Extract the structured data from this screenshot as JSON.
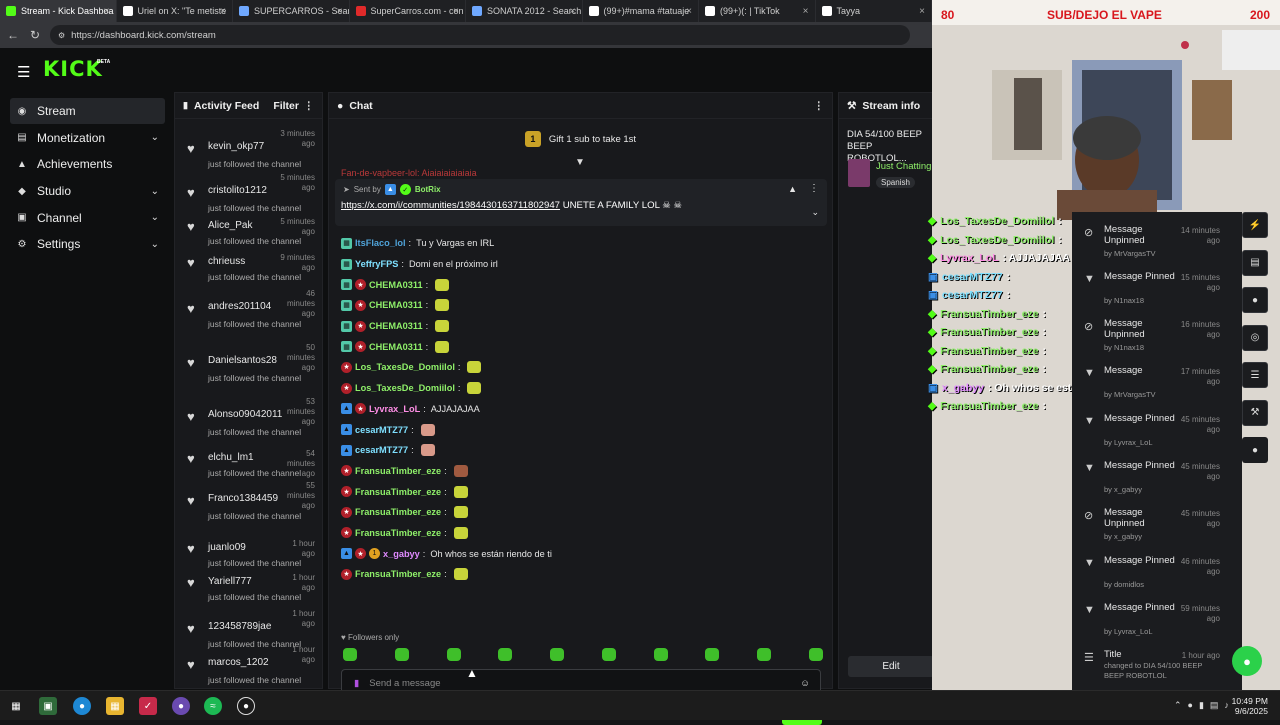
{
  "browser": {
    "tabs": [
      {
        "label": "Stream - Kick Dashboa",
        "icon": "kick-icon",
        "color": "#53fc18",
        "active": true
      },
      {
        "label": "Uriel on X: \"Te metiste",
        "icon": "x-icon",
        "color": "#ffffff",
        "active": false
      },
      {
        "label": "SUPERCARROS - Search",
        "icon": "search-icon",
        "color": "#6fa8ff",
        "active": false
      },
      {
        "label": "SuperCarros.com - con",
        "icon": "supercarros-icon",
        "color": "#e02a2a",
        "active": false
      },
      {
        "label": "SONATA 2012 - Search",
        "icon": "search-icon",
        "color": "#6fa8ff",
        "active": false
      },
      {
        "label": "(99+)#mama #tatuaje",
        "icon": "tiktok-icon",
        "color": "#ffffff",
        "active": false
      },
      {
        "label": "(99+)(: | TikTok",
        "icon": "tiktok-icon",
        "color": "#ffffff",
        "active": false
      },
      {
        "label": "Tayya",
        "icon": "tiktok-icon",
        "color": "#ffffff",
        "active": false
      }
    ],
    "url": "https://dashboard.kick.com/stream"
  },
  "brand": {
    "logo": "KICK",
    "beta": "BETA",
    "accent": "#53fc18"
  },
  "sidebar": {
    "items": [
      {
        "label": "Stream",
        "icon": "broadcast-icon",
        "active": true,
        "chevron": false
      },
      {
        "label": "Monetization",
        "icon": "wallet-icon",
        "active": false,
        "chevron": true
      },
      {
        "label": "Achievements",
        "icon": "trophy-icon",
        "active": false,
        "chevron": false
      },
      {
        "label": "Studio",
        "icon": "studio-icon",
        "active": false,
        "chevron": true
      },
      {
        "label": "Channel",
        "icon": "channel-icon",
        "active": false,
        "chevron": true
      },
      {
        "label": "Settings",
        "icon": "gear-icon",
        "active": false,
        "chevron": true
      }
    ]
  },
  "activity": {
    "title": "Activity Feed",
    "filter": "Filter",
    "items": [
      {
        "user": "kevin_okp77",
        "time": "3 minutes ago",
        "desc": "just followed the channel"
      },
      {
        "user": "cristolito1212",
        "time": "5 minutes ago",
        "desc": "just followed the channel"
      },
      {
        "user": "Alice_Pak",
        "time": "5 minutes ago",
        "desc": "just followed the channel"
      },
      {
        "user": "chrieuss",
        "time": "9 minutes ago",
        "desc": "just followed the channel"
      },
      {
        "user": "andres201104",
        "time": "46 minutes ago",
        "desc": "just followed the channel"
      },
      {
        "user": "Danielsantos28",
        "time": "50 minutes ago",
        "desc": "just followed the channel"
      },
      {
        "user": "Alonso09042011",
        "time": "53 minutes ago",
        "desc": "just followed the channel"
      },
      {
        "user": "elchu_lm1",
        "time": "54 minutes ago",
        "desc": "just followed the channel"
      },
      {
        "user": "Franco1384459",
        "time": "55 minutes ago",
        "desc": "just followed the channel"
      },
      {
        "user": "juanlo09",
        "time": "1 hour ago",
        "desc": "just followed the channel"
      },
      {
        "user": "Yariell777",
        "time": "1 hour ago",
        "desc": "just followed the channel"
      },
      {
        "user": "123458789jae",
        "time": "1 hour ago",
        "desc": "just followed the channel"
      },
      {
        "user": "marcos_1202",
        "time": "1 hour ago",
        "desc": "just followed the channel"
      }
    ]
  },
  "chat": {
    "title": "Chat",
    "gift_text": "Gift 1 sub to take 1st",
    "gift_rank": "1",
    "partial_msg": "Fan-de-vapbeer-lol: Aiaiaiaiaiaiaia",
    "pinned": {
      "sent_by": "Sent by",
      "bot": "BotRix",
      "link": "https://x.com/i/communities/1984430163711802947",
      "text": "UNETE A FAMILY LOL"
    },
    "messages": [
      {
        "user": "ItsFlaco_lol",
        "text": "Tu y Vargas en IRL",
        "color": "#4fa3d9",
        "emote": null
      },
      {
        "user": "YeffryFPS",
        "text": "Domi en el próximo irl",
        "color": "#7fe0ff",
        "emote": null
      },
      {
        "user": "CHEMA0311",
        "text": "",
        "color": "#8ff06a",
        "emote": "#c8d43a"
      },
      {
        "user": "CHEMA0311",
        "text": "",
        "color": "#8ff06a",
        "emote": "#c8d43a"
      },
      {
        "user": "CHEMA0311",
        "text": "",
        "color": "#8ff06a",
        "emote": "#c8d43a"
      },
      {
        "user": "CHEMA0311",
        "text": "",
        "color": "#8ff06a",
        "emote": "#c8d43a"
      },
      {
        "user": "Los_TaxesDe_Domiilol",
        "text": "",
        "color": "#8ff06a",
        "emote": "#c8d43a"
      },
      {
        "user": "Los_TaxesDe_Domiilol",
        "text": "",
        "color": "#8ff06a",
        "emote": "#c8d43a"
      },
      {
        "user": "Lyvrax_LoL",
        "text": "AJJAJAJAA",
        "color": "#ff8ee6",
        "emote": null
      },
      {
        "user": "cesarMTZ77",
        "text": "",
        "color": "#7fe0ff",
        "emote": "#d99a8a"
      },
      {
        "user": "cesarMTZ77",
        "text": "",
        "color": "#7fe0ff",
        "emote": "#d99a8a"
      },
      {
        "user": "FransuaTimber_eze",
        "text": "",
        "color": "#8ff06a",
        "emote": "#a05a40"
      },
      {
        "user": "FransuaTimber_eze",
        "text": "",
        "color": "#8ff06a",
        "emote": "#c8d43a"
      },
      {
        "user": "FransuaTimber_eze",
        "text": "",
        "color": "#8ff06a",
        "emote": "#c8d43a"
      },
      {
        "user": "FransuaTimber_eze",
        "text": "",
        "color": "#8ff06a",
        "emote": "#c8d43a"
      },
      {
        "user": "x_gabyy",
        "text": "Oh whos se están riendo de ti",
        "color": "#e08aff",
        "emote": null
      },
      {
        "user": "FransuaTimber_eze",
        "text": "",
        "color": "#8ff06a",
        "emote": "#c8d43a"
      }
    ],
    "followers_only": "Followers only",
    "input_placeholder": "Send a message",
    "send_label": "Chat"
  },
  "stream_info": {
    "title": "Stream info",
    "stream_title": "DIA 54/100 BEEP BEEP ROBOTLOL...",
    "category": "Just Chatting",
    "language": "Spanish",
    "edit_label": "Edit"
  },
  "overlay": {
    "sub_left": "80",
    "sub_title": "SUB/DEJO EL VAPE",
    "sub_right": "200",
    "chat": [
      {
        "user": "Los_TaxesDe_Domiilol",
        "text": ":",
        "color": "#8ff06a"
      },
      {
        "user": "Los_TaxesDe_Domiilol",
        "text": ":",
        "color": "#8ff06a"
      },
      {
        "user": "Lyvrax_LoL",
        "text": ": AJJAJAJAA",
        "color": "#ff8ee6"
      },
      {
        "user": "cesarMTZ77",
        "text": ":",
        "color": "#7fe0ff"
      },
      {
        "user": "cesarMTZ77",
        "text": ":",
        "color": "#7fe0ff"
      },
      {
        "user": "FransuaTimber_eze",
        "text": ":",
        "color": "#8ff06a"
      },
      {
        "user": "FransuaTimber_eze",
        "text": ":",
        "color": "#8ff06a"
      },
      {
        "user": "FransuaTimber_eze",
        "text": ":",
        "color": "#8ff06a"
      },
      {
        "user": "FransuaTimber_eze",
        "text": ":",
        "color": "#8ff06a"
      },
      {
        "user": "x_gabyy",
        "text": ": Oh whos se están riendo de ti",
        "color": "#e08aff"
      },
      {
        "user": "FransuaTimber_eze",
        "text": ":",
        "color": "#8ff06a"
      }
    ]
  },
  "modlog": [
    {
      "title": "Message Unpinned",
      "time": "14 minutes ago",
      "by": "by MrVargasTV",
      "icon": "unpin-icon"
    },
    {
      "title": "Message Pinned",
      "time": "15 minutes ago",
      "by": "by N1nax18",
      "icon": "pin-icon"
    },
    {
      "title": "Message Unpinned",
      "time": "16 minutes ago",
      "by": "by N1nax18",
      "icon": "unpin-icon"
    },
    {
      "title": "Message",
      "time": "17 minutes ago",
      "by": "by MrVargasTV",
      "icon": "pin-icon"
    },
    {
      "title": "Message Pinned",
      "time": "45 minutes ago",
      "by": "by Lyvrax_LoL",
      "icon": "pin-icon"
    },
    {
      "title": "Message Pinned",
      "time": "45 minutes ago",
      "by": "by x_gabyy",
      "icon": "pin-icon"
    },
    {
      "title": "Message Unpinned",
      "time": "45 minutes ago",
      "by": "by x_gabyy",
      "icon": "unpin-icon"
    },
    {
      "title": "Message Pinned",
      "time": "46 minutes ago",
      "by": "by domidlos",
      "icon": "pin-icon"
    },
    {
      "title": "Message Pinned",
      "time": "59 minutes ago",
      "by": "by Lyvrax_LoL",
      "icon": "pin-icon"
    },
    {
      "title": "Title",
      "time": "1 hour ago",
      "by": "changed to DIA 54/100 BEEP BEEP ROBOTLOL",
      "icon": "title-icon"
    }
  ],
  "taskbar": {
    "time": "10:49 PM",
    "date": "9/6/2025"
  }
}
